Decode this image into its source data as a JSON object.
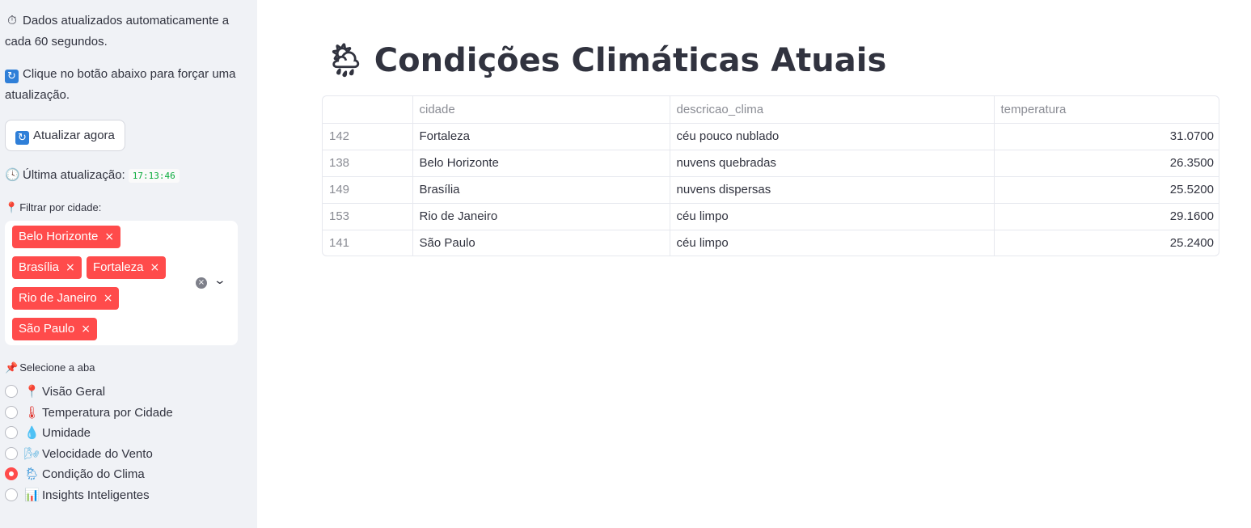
{
  "sidebar": {
    "auto_update_icon": "stopwatch-icon",
    "auto_update_text": "Dados atualizados automaticamente a cada 60 segundos.",
    "force_update_icon": "refresh-icon",
    "force_update_text": "Clique no botão abaixo para forçar uma atualização.",
    "update_button_label": "Atualizar agora",
    "last_update_label": "Última atualização:",
    "last_update_time": "17:13:46",
    "filter_label": "Filtrar por cidade:",
    "filter_chips": [
      "Belo Horizonte",
      "Brasília",
      "Fortaleza",
      "Rio de Janeiro",
      "São Paulo"
    ],
    "tab_select_label": "Selecione a aba",
    "tabs": [
      {
        "icon": "pin-icon",
        "label": "Visão Geral",
        "selected": false
      },
      {
        "icon": "thermometer-icon",
        "label": "Temperatura por Cidade",
        "selected": false
      },
      {
        "icon": "droplet-icon",
        "label": "Umidade",
        "selected": false
      },
      {
        "icon": "wind-icon",
        "label": "Velocidade do Vento",
        "selected": false
      },
      {
        "icon": "weather-icon",
        "label": "Condição do Clima",
        "selected": true
      },
      {
        "icon": "bar-chart-icon",
        "label": "Insights Inteligentes",
        "selected": false
      }
    ]
  },
  "main": {
    "title_icon": "sun-rain-cloud-icon",
    "title": "Condições Climáticas Atuais",
    "table": {
      "columns": [
        "",
        "cidade",
        "descricao_clima",
        "temperatura"
      ],
      "rows": [
        {
          "index": "142",
          "cidade": "Fortaleza",
          "descricao_clima": "céu pouco nublado",
          "temperatura": "31.0700"
        },
        {
          "index": "138",
          "cidade": "Belo Horizonte",
          "descricao_clima": "nuvens quebradas",
          "temperatura": "26.3500"
        },
        {
          "index": "149",
          "cidade": "Brasília",
          "descricao_clima": "nuvens dispersas",
          "temperatura": "25.5200"
        },
        {
          "index": "153",
          "cidade": "Rio de Janeiro",
          "descricao_clima": "céu limpo",
          "temperatura": "29.1600"
        },
        {
          "index": "141",
          "cidade": "São Paulo",
          "descricao_clima": "céu limpo",
          "temperatura": "25.2400"
        }
      ]
    }
  },
  "colors": {
    "accent": "#ff4b4b",
    "sidebar_bg": "#f0f2f6",
    "code_text": "#09ab3b"
  }
}
